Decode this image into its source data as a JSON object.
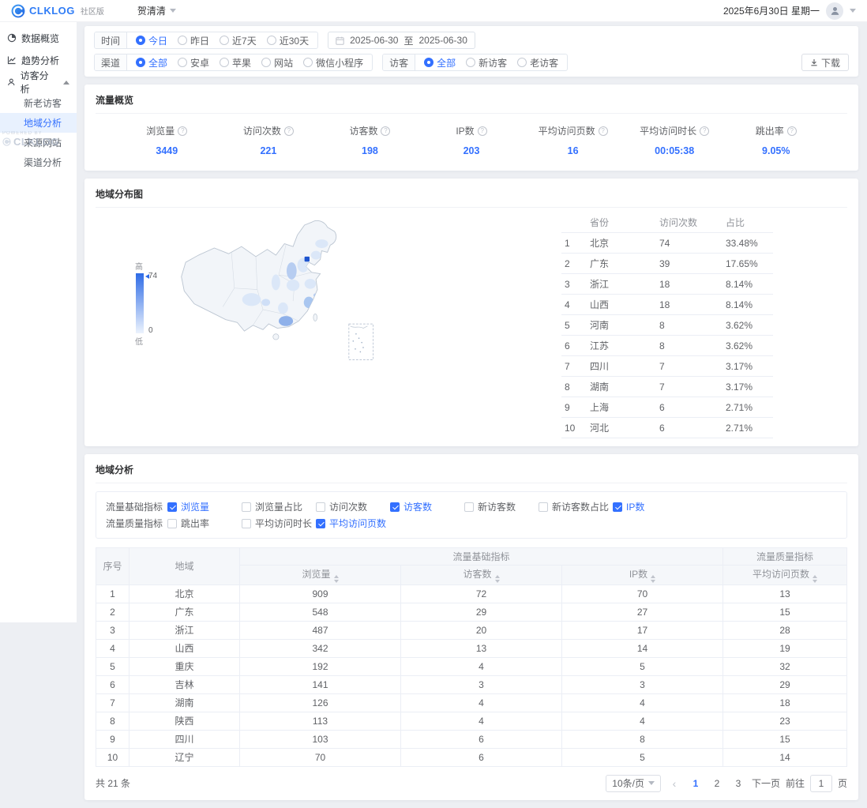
{
  "header": {
    "logo_text": "CLKLOG",
    "edition": "社区版",
    "project": "贺清清",
    "date_display": "2025年6月30日 星期一"
  },
  "sidebar": {
    "items": [
      {
        "label": "数据概览"
      },
      {
        "label": "趋势分析"
      },
      {
        "label": "访客分析"
      }
    ],
    "sub_items": [
      {
        "label": "新老访客"
      },
      {
        "label": "地域分析"
      },
      {
        "label": "来源网站"
      },
      {
        "label": "渠道分析"
      }
    ],
    "active_sub_item": "地域分析",
    "watermark": {
      "small": "POWERED BY",
      "brand": "CLKLOG"
    }
  },
  "filters": {
    "time": {
      "label": "时间",
      "options": [
        "今日",
        "昨日",
        "近7天",
        "近30天"
      ],
      "selected": "今日"
    },
    "date_range": {
      "from": "2025-06-30",
      "separator": "至",
      "to": "2025-06-30"
    },
    "channel": {
      "label": "渠道",
      "options": [
        "全部",
        "安卓",
        "苹果",
        "网站",
        "微信小程序"
      ],
      "selected": "全部"
    },
    "visitor": {
      "label": "访客",
      "options": [
        "全部",
        "新访客",
        "老访客"
      ],
      "selected": "全部"
    },
    "download_label": "下载"
  },
  "overview": {
    "title": "流量概览",
    "value_color": "#3370ff",
    "metrics": [
      {
        "label": "浏览量",
        "value": "3449"
      },
      {
        "label": "访问次数",
        "value": "221"
      },
      {
        "label": "访客数",
        "value": "198"
      },
      {
        "label": "IP数",
        "value": "203"
      },
      {
        "label": "平均访问页数",
        "value": "16"
      },
      {
        "label": "平均访问时长",
        "value": "00:05:38"
      },
      {
        "label": "跳出率",
        "value": "9.05%"
      }
    ]
  },
  "map_section": {
    "title": "地域分布图",
    "legend": {
      "high": "高",
      "low": "低",
      "max": "74",
      "min": "0"
    },
    "table": {
      "headers": {
        "province": "省份",
        "visits": "访问次数",
        "ratio": "占比"
      },
      "rows": [
        {
          "rank": "1",
          "province": "北京",
          "visits": "74",
          "ratio": "33.48%"
        },
        {
          "rank": "2",
          "province": "广东",
          "visits": "39",
          "ratio": "17.65%"
        },
        {
          "rank": "3",
          "province": "浙江",
          "visits": "18",
          "ratio": "8.14%"
        },
        {
          "rank": "4",
          "province": "山西",
          "visits": "18",
          "ratio": "8.14%"
        },
        {
          "rank": "5",
          "province": "河南",
          "visits": "8",
          "ratio": "3.62%"
        },
        {
          "rank": "6",
          "province": "江苏",
          "visits": "8",
          "ratio": "3.62%"
        },
        {
          "rank": "7",
          "province": "四川",
          "visits": "7",
          "ratio": "3.17%"
        },
        {
          "rank": "8",
          "province": "湖南",
          "visits": "7",
          "ratio": "3.17%"
        },
        {
          "rank": "9",
          "province": "上海",
          "visits": "6",
          "ratio": "2.71%"
        },
        {
          "rank": "10",
          "province": "河北",
          "visits": "6",
          "ratio": "2.71%"
        }
      ]
    }
  },
  "analysis": {
    "title": "地域分析",
    "metric_filters": {
      "basic": {
        "label": "流量基础指标",
        "options": [
          {
            "label": "浏览量",
            "checked": true
          },
          {
            "label": "浏览量占比",
            "checked": false
          },
          {
            "label": "访问次数",
            "checked": false
          },
          {
            "label": "访客数",
            "checked": true
          },
          {
            "label": "新访客数",
            "checked": false
          },
          {
            "label": "新访客数占比",
            "checked": false
          },
          {
            "label": "IP数",
            "checked": true
          }
        ]
      },
      "quality": {
        "label": "流量质量指标",
        "options": [
          {
            "label": "跳出率",
            "checked": false
          },
          {
            "label": "平均访问时长",
            "checked": false
          },
          {
            "label": "平均访问页数",
            "checked": true
          }
        ]
      }
    },
    "table": {
      "col_no": "序号",
      "col_region": "地域",
      "group_basic": "流量基础指标",
      "group_quality": "流量质量指标",
      "cols": [
        "浏览量",
        "访客数",
        "IP数",
        "平均访问页数"
      ],
      "rows": [
        {
          "no": "1",
          "region": "北京",
          "pv": "909",
          "uv": "72",
          "ip": "70",
          "pages": "13"
        },
        {
          "no": "2",
          "region": "广东",
          "pv": "548",
          "uv": "29",
          "ip": "27",
          "pages": "15"
        },
        {
          "no": "3",
          "region": "浙江",
          "pv": "487",
          "uv": "20",
          "ip": "17",
          "pages": "28"
        },
        {
          "no": "4",
          "region": "山西",
          "pv": "342",
          "uv": "13",
          "ip": "14",
          "pages": "19"
        },
        {
          "no": "5",
          "region": "重庆",
          "pv": "192",
          "uv": "4",
          "ip": "5",
          "pages": "32"
        },
        {
          "no": "6",
          "region": "吉林",
          "pv": "141",
          "uv": "3",
          "ip": "3",
          "pages": "29"
        },
        {
          "no": "7",
          "region": "湖南",
          "pv": "126",
          "uv": "4",
          "ip": "4",
          "pages": "18"
        },
        {
          "no": "8",
          "region": "陕西",
          "pv": "113",
          "uv": "4",
          "ip": "4",
          "pages": "23"
        },
        {
          "no": "9",
          "region": "四川",
          "pv": "103",
          "uv": "6",
          "ip": "8",
          "pages": "15"
        },
        {
          "no": "10",
          "region": "辽宁",
          "pv": "70",
          "uv": "6",
          "ip": "5",
          "pages": "14"
        }
      ]
    },
    "footer": {
      "total": "共 21 条",
      "page_size": "10条/页",
      "prev_icon": "‹",
      "pages": [
        "1",
        "2",
        "3"
      ],
      "current_page": "1",
      "next_label": "下一页",
      "jump_prefix": "前往",
      "jump_value": "1",
      "jump_suffix": "页"
    }
  }
}
